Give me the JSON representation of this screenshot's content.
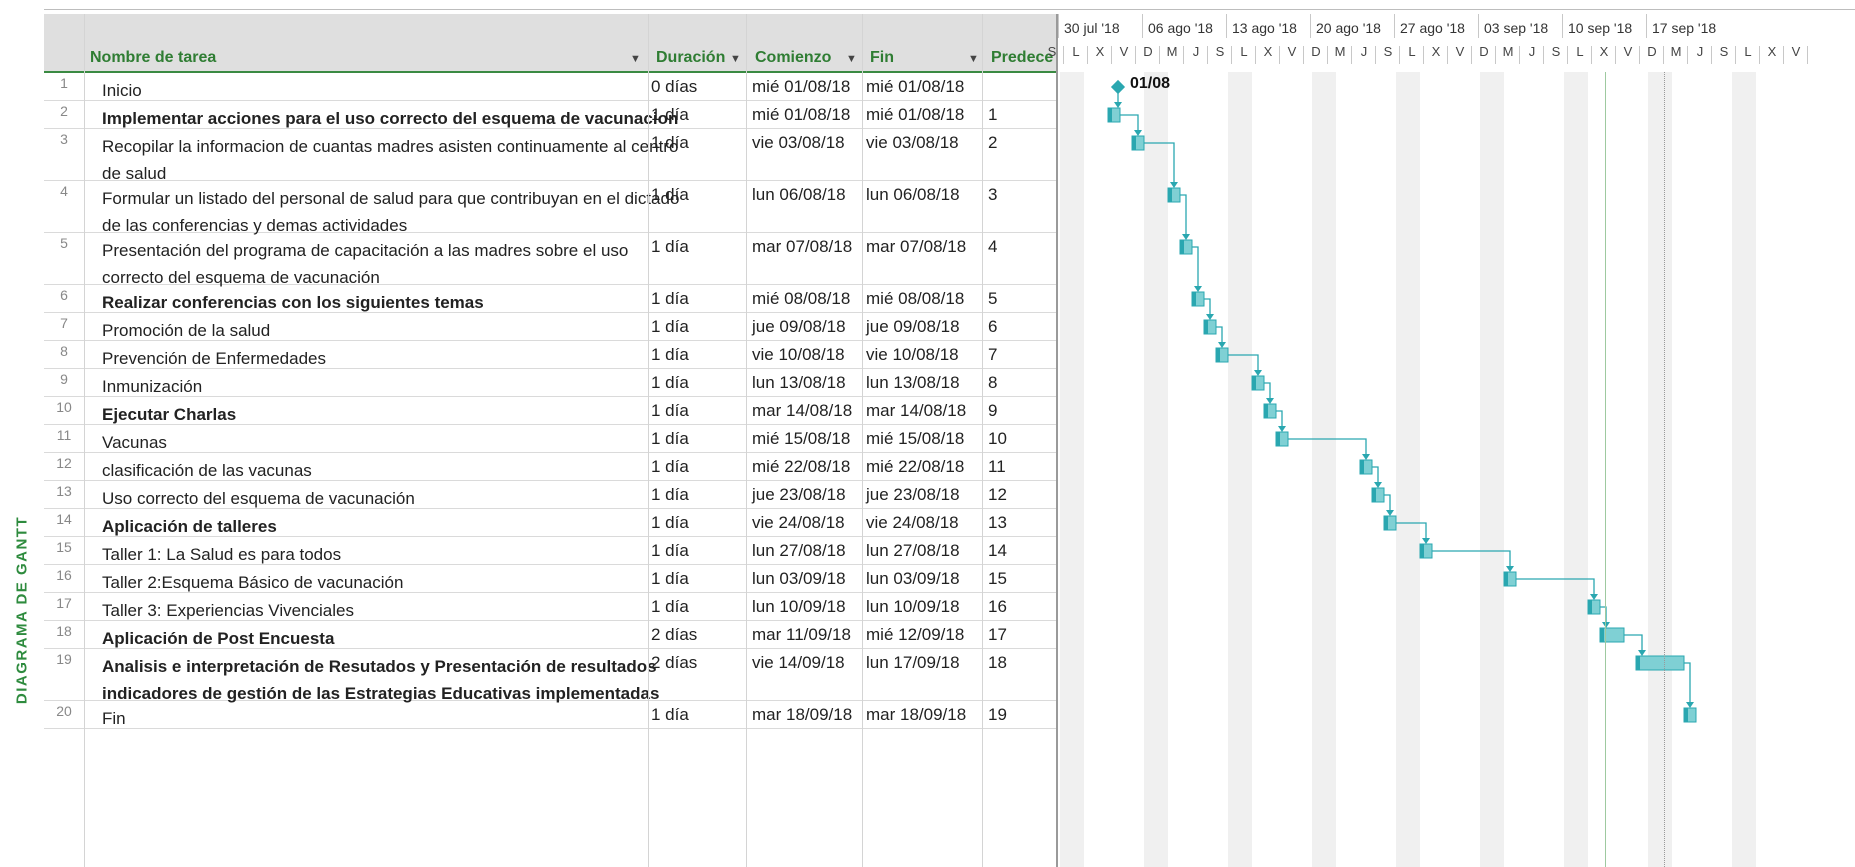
{
  "side_label": "DIAGRAMA DE GANTT",
  "columns": {
    "name": "Nombre de tarea",
    "duration": "Duración",
    "start": "Comienzo",
    "finish": "Fin",
    "predecessors": "Predecesora"
  },
  "timescale": {
    "weeks": [
      "30 jul '18",
      "06 ago '18",
      "13 ago '18",
      "20 ago '18",
      "27 ago '18",
      "03 sep '18",
      "10 sep '18",
      "17 sep '18"
    ],
    "day_letters": [
      "S",
      "L",
      "X",
      "V",
      "D",
      "M",
      "J"
    ]
  },
  "milestone_label": "01/08",
  "colors": {
    "accent": "#2f7d33",
    "bar": "#7fd0d4",
    "bar_border": "#2aa7b0",
    "link": "#2aa7b0",
    "header_bg": "#dfdfdf",
    "nonwork": "#f0f0f0"
  },
  "tasks": [
    {
      "id": "1",
      "name": "Inicio",
      "duration": "0 días",
      "start": "mié 01/08/18",
      "finish": "mié 01/08/18",
      "pred": "",
      "bold": false
    },
    {
      "id": "2",
      "name": "Implementar acciones para el uso correcto del esquema de vacunacion",
      "duration": "1 día",
      "start": "mié 01/08/18",
      "finish": "mié 01/08/18",
      "pred": "1",
      "bold": true
    },
    {
      "id": "3",
      "name": "Recopilar la informacion de cuantas madres asisten continuamente al centro de salud",
      "duration": "1 día",
      "start": "vie 03/08/18",
      "finish": "vie 03/08/18",
      "pred": "2",
      "bold": false
    },
    {
      "id": "4",
      "name": "Formular un listado del personal de salud para que contribuyan en el dictado de las conferencias y demas actividades",
      "duration": "1 día",
      "start": "lun 06/08/18",
      "finish": "lun 06/08/18",
      "pred": "3",
      "bold": false
    },
    {
      "id": "5",
      "name": "Presentación del programa de capacitación a las madres sobre el uso correcto del esquema de vacunación",
      "duration": "1 día",
      "start": "mar 07/08/18",
      "finish": "mar 07/08/18",
      "pred": "4",
      "bold": false
    },
    {
      "id": "6",
      "name": "Realizar conferencias con los siguientes temas",
      "duration": "1 día",
      "start": "mié 08/08/18",
      "finish": "mié 08/08/18",
      "pred": "5",
      "bold": true
    },
    {
      "id": "7",
      "name": "Promoción de la salud",
      "duration": "1 día",
      "start": "jue 09/08/18",
      "finish": "jue 09/08/18",
      "pred": "6",
      "bold": false
    },
    {
      "id": "8",
      "name": "Prevención de Enfermedades",
      "duration": "1 día",
      "start": "vie 10/08/18",
      "finish": "vie 10/08/18",
      "pred": "7",
      "bold": false
    },
    {
      "id": "9",
      "name": "Inmunización",
      "duration": "1 día",
      "start": "lun 13/08/18",
      "finish": "lun 13/08/18",
      "pred": "8",
      "bold": false
    },
    {
      "id": "10",
      "name": "Ejecutar Charlas",
      "duration": "1 día",
      "start": "mar 14/08/18",
      "finish": "mar 14/08/18",
      "pred": "9",
      "bold": true
    },
    {
      "id": "11",
      "name": "Vacunas",
      "duration": "1 día",
      "start": "mié 15/08/18",
      "finish": "mié 15/08/18",
      "pred": "10",
      "bold": false
    },
    {
      "id": "12",
      "name": "clasificación de las vacunas",
      "duration": "1 día",
      "start": "mié 22/08/18",
      "finish": "mié 22/08/18",
      "pred": "11",
      "bold": false
    },
    {
      "id": "13",
      "name": "Uso correcto del esquema de vacunación",
      "duration": "1 día",
      "start": "jue 23/08/18",
      "finish": "jue 23/08/18",
      "pred": "12",
      "bold": false
    },
    {
      "id": "14",
      "name": "Aplicación de talleres",
      "duration": "1 día",
      "start": "vie 24/08/18",
      "finish": "vie 24/08/18",
      "pred": "13",
      "bold": true
    },
    {
      "id": "15",
      "name": "Taller 1: La Salud es para todos",
      "duration": "1 día",
      "start": "lun 27/08/18",
      "finish": "lun 27/08/18",
      "pred": "14",
      "bold": false
    },
    {
      "id": "16",
      "name": "Taller 2:Esquema Básico de vacunación",
      "duration": "1 día",
      "start": "lun 03/09/18",
      "finish": "lun 03/09/18",
      "pred": "15",
      "bold": false
    },
    {
      "id": "17",
      "name": "Taller 3: Experiencias Vivenciales",
      "duration": "1 día",
      "start": "lun 10/09/18",
      "finish": "lun 10/09/18",
      "pred": "16",
      "bold": false
    },
    {
      "id": "18",
      "name": "Aplicación de Post Encuesta",
      "duration": "2 días",
      "start": "mar 11/09/18",
      "finish": "mié 12/09/18",
      "pred": "17",
      "bold": true
    },
    {
      "id": "19",
      "name": "Analisis e interpretación de Resutados y Presentación de resultados indicadores de gestión de las Estrategias Educativas implementadas",
      "duration": "2 días",
      "start": "vie 14/09/18",
      "finish": "lun 17/09/18",
      "pred": "18",
      "bold": true
    },
    {
      "id": "20",
      "name": "Fin",
      "duration": "1 día",
      "start": "mar 18/09/18",
      "finish": "mar 18/09/18",
      "pred": "19",
      "bold": false
    }
  ]
}
